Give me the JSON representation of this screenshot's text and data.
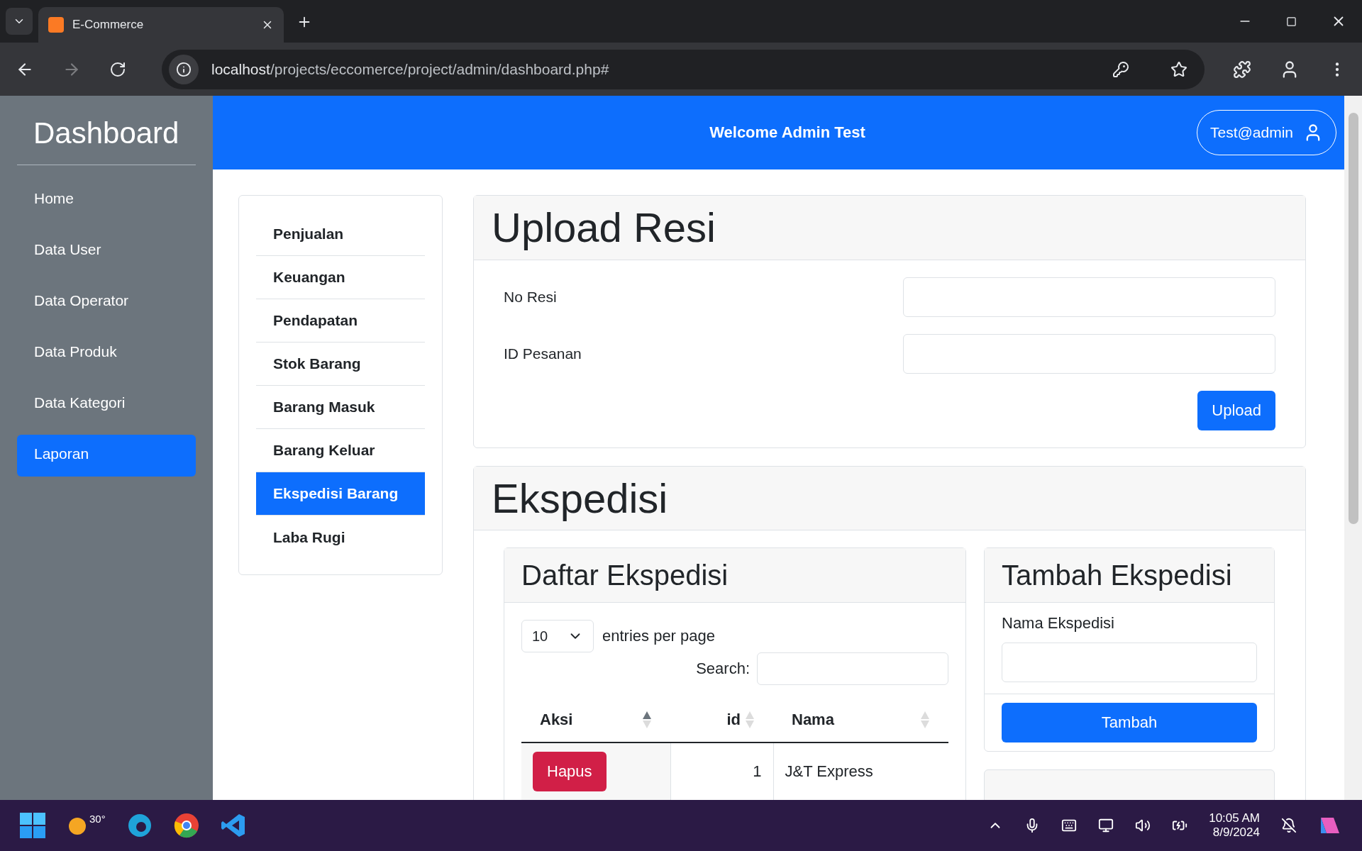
{
  "browser": {
    "tab_title": "E-Commerce",
    "url_host": "localhost",
    "url_path": "/projects/eccomerce/project/admin/dashboard.php#"
  },
  "sidebar": {
    "title": "Dashboard",
    "items": [
      {
        "label": "Home",
        "selected": false
      },
      {
        "label": "Data User",
        "selected": false
      },
      {
        "label": "Data Operator",
        "selected": false
      },
      {
        "label": "Data Produk",
        "selected": false
      },
      {
        "label": "Data Kategori",
        "selected": false
      },
      {
        "label": "Laporan",
        "selected": true
      }
    ]
  },
  "header": {
    "welcome": "Welcome Admin Test",
    "user_button": "Test@admin"
  },
  "report_menu": [
    {
      "label": "Penjualan",
      "selected": false
    },
    {
      "label": "Keuangan",
      "selected": false
    },
    {
      "label": "Pendapatan",
      "selected": false
    },
    {
      "label": "Stok Barang",
      "selected": false
    },
    {
      "label": "Barang Masuk",
      "selected": false
    },
    {
      "label": "Barang Keluar",
      "selected": false
    },
    {
      "label": "Ekspedisi Barang",
      "selected": true
    },
    {
      "label": "Laba Rugi",
      "selected": false
    }
  ],
  "upload_card": {
    "title": "Upload Resi",
    "fields": [
      {
        "label": "No Resi"
      },
      {
        "label": "ID Pesanan"
      }
    ],
    "button": "Upload"
  },
  "ekspedisi_card": {
    "title": "Ekspedisi",
    "list": {
      "title": "Daftar Ekspedisi",
      "page_size": "10",
      "page_size_label": "entries per page",
      "search_label": "Search:",
      "columns": [
        {
          "label": "Aksi",
          "sorted": true
        },
        {
          "label": "id",
          "sorted": false
        },
        {
          "label": "Nama",
          "sorted": false
        }
      ],
      "rows": [
        {
          "action": "Hapus",
          "id": "1",
          "name": "J&T Express"
        }
      ]
    },
    "add": {
      "title": "Tambah Ekspedisi",
      "field_label": "Nama Ekspedisi",
      "button": "Tambah"
    }
  },
  "taskbar": {
    "weather": "30°",
    "time": "10:05 AM",
    "date": "8/9/2024"
  }
}
